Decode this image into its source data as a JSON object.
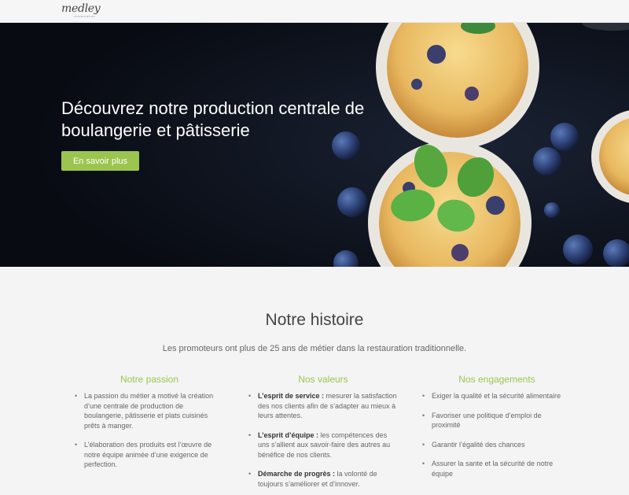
{
  "header": {
    "logo_text": "medley",
    "logo_tagline": "restauration"
  },
  "hero": {
    "title": "Découvrez notre production centrale de boulangerie et pâtisserie",
    "button_label": "En savoir plus"
  },
  "story": {
    "title": "Notre histoire",
    "intro": "Les promoteurs ont plus de 25 ans de métier dans la restauration traditionnelle.",
    "columns": [
      {
        "heading": "Notre passion",
        "items": [
          {
            "strong": "",
            "text": "La passion du métier a motivé la création d’une centrale de production de boulangerie, pâtisserie et plats cuisinés prêts à manger."
          },
          {
            "strong": "",
            "text": "L’élaboration des produits est l’œuvre de notre équipe animée d’une exigence de perfection."
          }
        ]
      },
      {
        "heading": "Nos valeurs",
        "items": [
          {
            "strong": "L’esprit de service :",
            "text": " mesurer la satisfaction des nos clients afin de s’adapter au mieux à leurs attentes."
          },
          {
            "strong": "L’esprit d’équipe :",
            "text": " les compétences des uns s’allient aux savoir-faire des autres au bénéfice de nos clients."
          },
          {
            "strong": "Démarche de progrès :",
            "text": " la volonté de toujours s’améliorer et d’innover."
          }
        ]
      },
      {
        "heading": "Nos engagements",
        "items": [
          {
            "strong": "",
            "text": "Exiger la qualité et la sécurité alimentaire"
          },
          {
            "strong": "",
            "text": "Favoriser une politique d’emploi de proximité"
          },
          {
            "strong": "",
            "text": "Garantir l’égalité des chances"
          },
          {
            "strong": "",
            "text": "Assurer la sante et la sécurité de notre équipe"
          }
        ]
      }
    ]
  },
  "colors": {
    "accent": "#9bc54f",
    "hero_bg": "#0c111b"
  }
}
